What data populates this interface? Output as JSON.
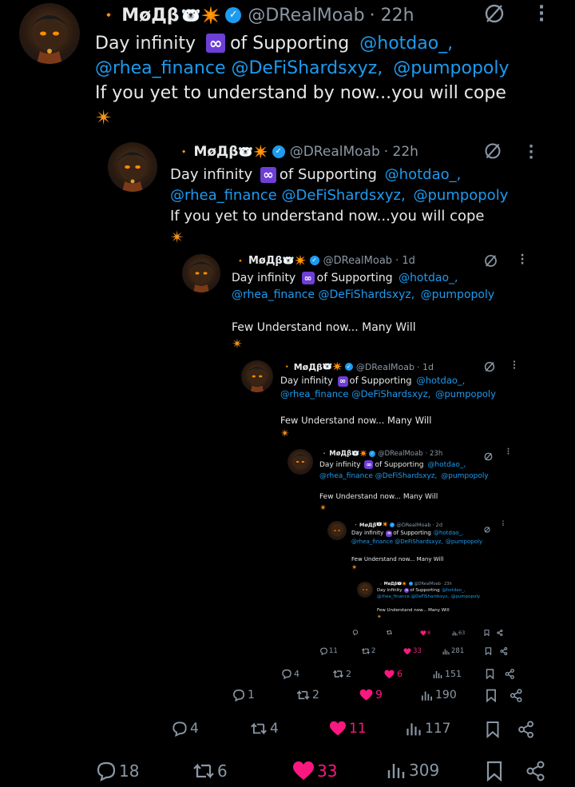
{
  "author": {
    "name": "MøДβ",
    "handle": "@DRealMoab",
    "diamond": "🔸",
    "emojis": "🐻‍❄️✴️"
  },
  "t1": {
    "time": "· 22h",
    "l1a": "Day infinity",
    "l1b": "of  Supporting",
    "m1": "@hotdao_,",
    "m2": "@rhea_finance",
    "m3": "@DeFiShardsxyz,",
    "m4": "@pumpopoly",
    "l3": "If you yet to understand by now...you will cope",
    "spark": "✴",
    "stats": {
      "replies": "18",
      "reposts": "6",
      "likes": "33",
      "views": "309"
    }
  },
  "t2": {
    "time": "· 22h",
    "l1a": "Day infinity",
    "l1b": "of  Supporting",
    "m1": "@hotdao_,",
    "m2": "@rhea_finance",
    "m3": "@DeFiShardsxyz,",
    "m4": "@pumpopoly",
    "l3": "If you yet to understand now...you will cope",
    "spark": "✴",
    "stats": {
      "replies": "4",
      "reposts": "4",
      "likes": "11",
      "views": "117"
    }
  },
  "t3": {
    "time": "· 1d",
    "l1a": "Day infinity",
    "l1b": "of  Supporting",
    "m1": "@hotdao_,",
    "m2": "@rhea_finance",
    "m3": "@DeFiShardsxyz,",
    "m4": "@pumpopoly",
    "l3": "Few Understand now... Many Will",
    "spark": "✴",
    "stats": {
      "replies": "1",
      "reposts": "2",
      "likes": "9",
      "views": "190"
    }
  },
  "t4": {
    "time": "· 1d",
    "l1a": "Day infinity",
    "l1b": "of Supporting",
    "m1": "@hotdao_,",
    "m2": "@rhea_finance",
    "m3": "@DeFiShardsxyz,",
    "m4": "@pumpopoly",
    "l3": "Few Understand now... Many Will",
    "spark": "✴",
    "stats": {
      "replies": "4",
      "reposts": "2",
      "likes": "6",
      "views": "151"
    }
  },
  "t5": {
    "time": "· 23h",
    "l1a": "Day infinity",
    "l1b": "of Supporting",
    "m1": "@hotdao_,",
    "m2": "@rhea_finance",
    "m3": "@DeFiShardsxyz,",
    "m4": "@pumpopoly",
    "l3": "Few Understand now... Many Will",
    "spark": "✴",
    "stats": {
      "replies": "11",
      "reposts": "2",
      "likes": "33",
      "views": "281"
    }
  },
  "t6": {
    "time": "· 2d",
    "l1a": "Day infinity",
    "l1b": "of Supporting",
    "m1": "@hotdao_,",
    "m2": "@rhea_finance",
    "m3": "@DeFiShardsxyz,",
    "m4": "@pumpopoly",
    "l3": "Few Understand now... Many Will",
    "spark": "✴",
    "stats": {
      "replies": "",
      "reposts": "",
      "likes": "8",
      "views": "63"
    }
  },
  "t7": {
    "time": "· 23h",
    "l1a": "Day infinity",
    "l1b": "of Supporting",
    "m1": "@hotdao_,",
    "m2": "@rhea_finance",
    "m3": "@DeFiShardsxyz,",
    "m4": "@pumpopoly",
    "l3": "Few Understand now... Many Will",
    "spark": "✴"
  },
  "infinity": "∞",
  "verified_check": "✓",
  "colors": {
    "link": "#1d9bf0",
    "like": "#f91880",
    "muted": "#8b98a5",
    "diamond": "#f7931a",
    "infinity_bg": "#6e3fd6"
  },
  "icons": [
    "reply-icon",
    "repost-icon",
    "like-icon",
    "views-icon",
    "bookmark-icon",
    "share-icon",
    "grok-icon",
    "more-icon"
  ]
}
